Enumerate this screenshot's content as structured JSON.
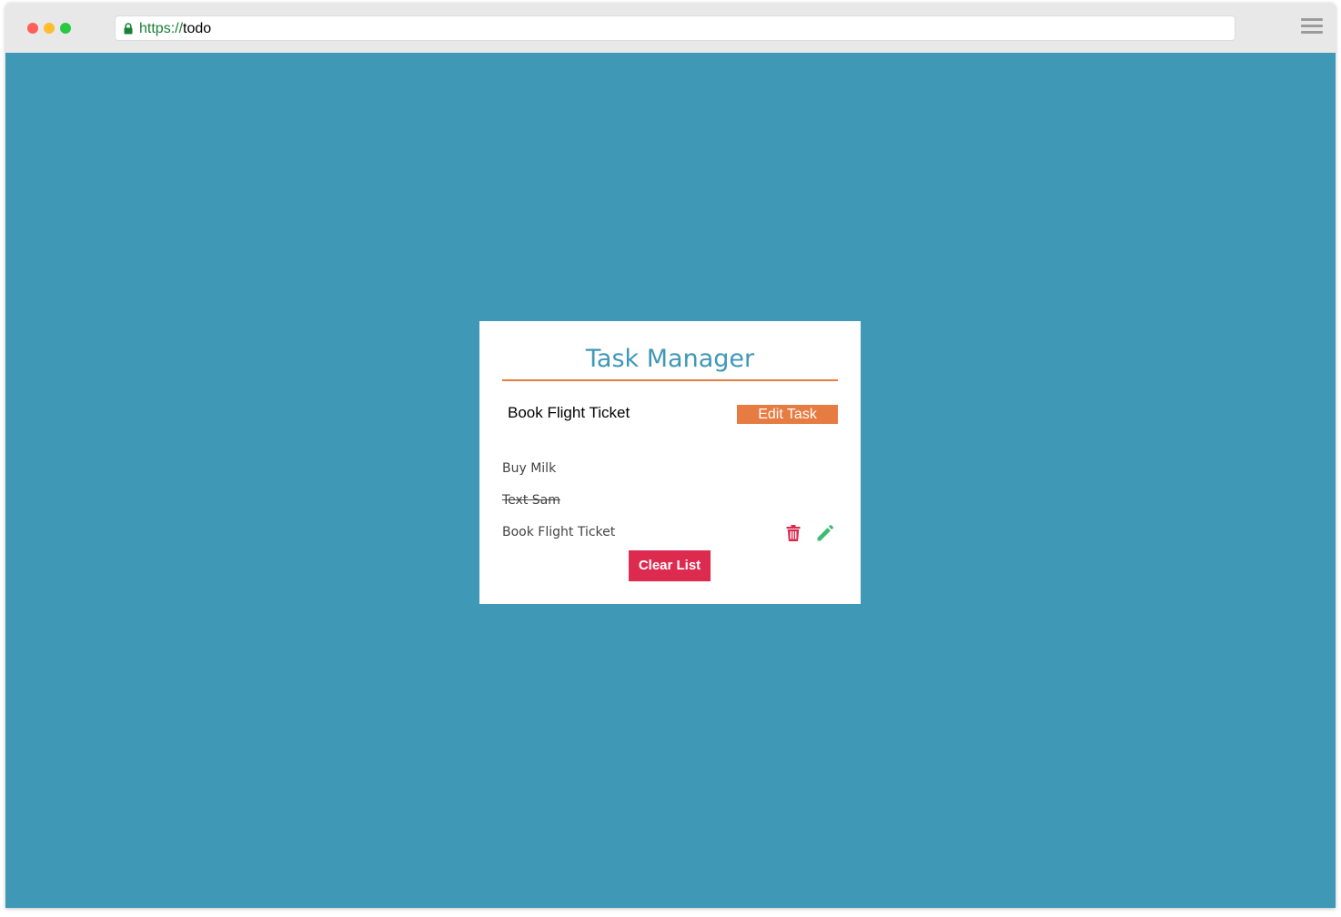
{
  "browser": {
    "url_scheme": "https://",
    "url_host": "todo",
    "traffic_lights": {
      "close": "#fe5f57",
      "minimize": "#febc2e",
      "zoom": "#28c840"
    }
  },
  "theme": {
    "background": "#3f98b6",
    "accent": "#e67c42",
    "danger": "#dc2b4f",
    "edit_icon_color": "#3dbb72"
  },
  "app": {
    "title": "Task Manager",
    "edit_input_value": "Book Flight Ticket",
    "edit_button_label": "Edit Task",
    "clear_button_label": "Clear List",
    "tasks": [
      {
        "label": "Buy Milk",
        "done": false
      },
      {
        "label": "Text Sam",
        "done": true
      },
      {
        "label": "Book Flight Ticket",
        "done": false
      }
    ]
  }
}
